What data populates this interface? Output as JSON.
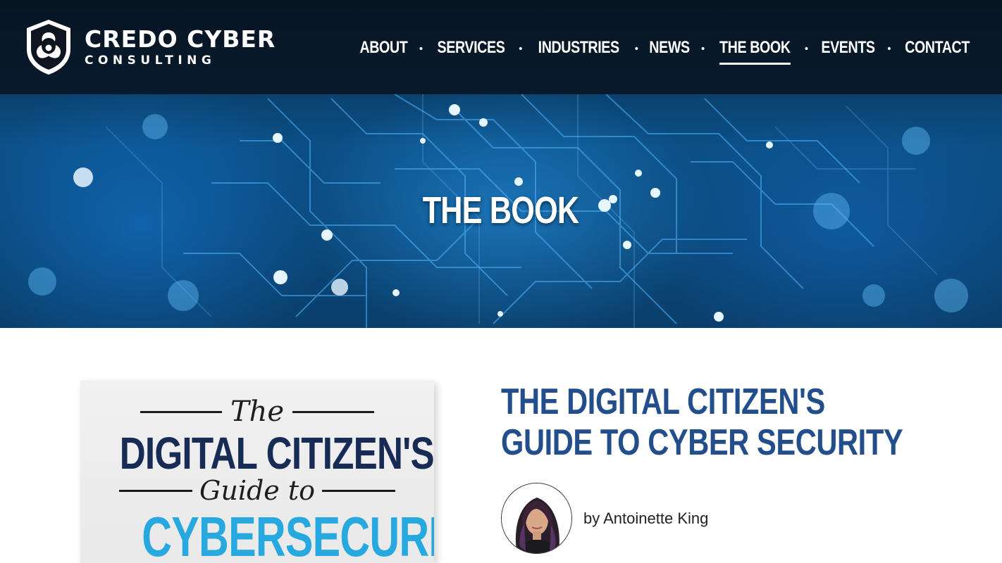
{
  "brand": {
    "name_line1": "CREDO CYBER",
    "name_line2": "CONSULTING",
    "logo_icon": "biohazard-shield-icon"
  },
  "nav": {
    "items": [
      {
        "label": "ABOUT",
        "active": false
      },
      {
        "label": "SERVICES",
        "active": false
      },
      {
        "label": "INDUSTRIES",
        "active": false
      },
      {
        "label": "NEWS",
        "active": false
      },
      {
        "label": "THE BOOK",
        "active": true
      },
      {
        "label": "EVENTS",
        "active": false
      },
      {
        "label": "CONTACT",
        "active": false
      }
    ],
    "separator": "•"
  },
  "hero": {
    "title": "THE BOOK"
  },
  "book": {
    "cover": {
      "the": "The",
      "digital": "DIGITAL CITIZEN'S",
      "guide": "Guide to",
      "cyber": "CYBERSECURITY"
    },
    "title_line1": "THE DIGITAL CITIZEN'S",
    "title_line2": "GUIDE TO CYBER SECURITY",
    "author": "by Antoinette King"
  },
  "colors": {
    "title_blue": "#234e8c",
    "cover_navy": "#172b55",
    "cover_cyan": "#27a9df",
    "topbar_bg": "#06101a"
  }
}
